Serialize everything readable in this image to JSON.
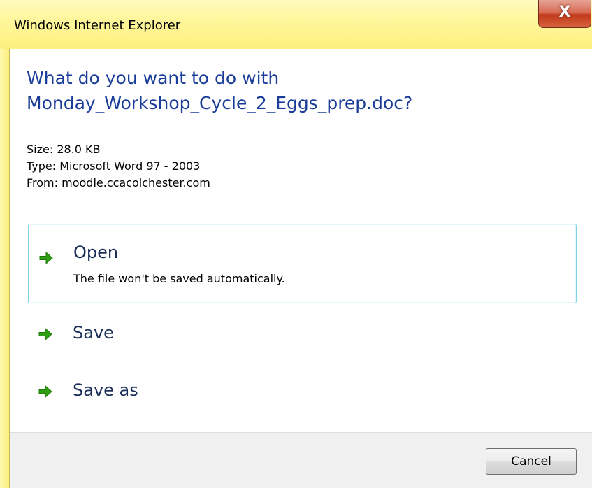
{
  "window": {
    "title": "Windows Internet Explorer",
    "close_label": "X"
  },
  "prompt": {
    "line1": "What do you want to do with",
    "line2": "Monday_Workshop_Cycle_2_Eggs_prep.doc?"
  },
  "file_info": {
    "size": "Size: 28.0 KB",
    "type": "Type: Microsoft Word 97 - 2003",
    "from": "From: moodle.ccacolchester.com"
  },
  "options": [
    {
      "label": "Open",
      "description": "The file won't be saved automatically.",
      "selected": true
    },
    {
      "label": "Save"
    },
    {
      "label": "Save as"
    }
  ],
  "footer": {
    "cancel_label": "Cancel"
  },
  "colors": {
    "frame": "#fff7a0",
    "heading": "#1a3d99",
    "arrow": "#2e9e12",
    "selected_border": "#7ed4e6",
    "close_button": "#c13a1c"
  },
  "icons": {
    "option_arrow": "green-right-arrow-icon",
    "close": "close-icon"
  }
}
